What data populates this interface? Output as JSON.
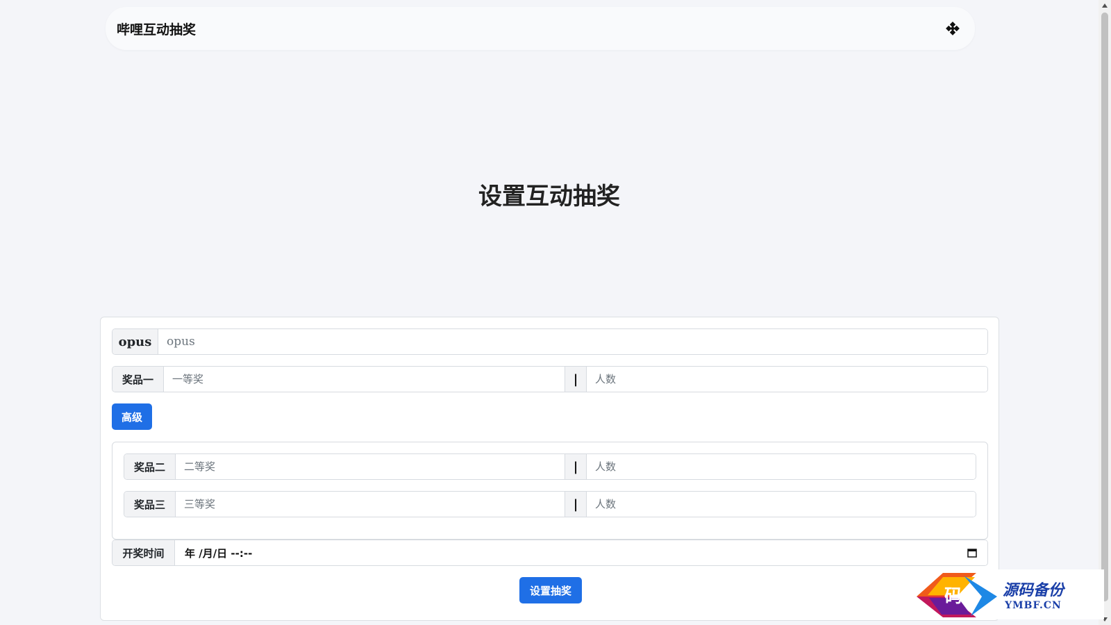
{
  "navbar": {
    "brand": "哔哩互动抽奖",
    "theme_icon": "theme-toggle-icon"
  },
  "main": {
    "title": "设置互动抽奖"
  },
  "form": {
    "opus": {
      "label": "opus",
      "placeholder": "opus",
      "value": ""
    },
    "prize1": {
      "label": "奖品一",
      "name_placeholder": "一等奖",
      "separator": "|",
      "count_placeholder": "人数"
    },
    "advanced_button": "高级",
    "prize2": {
      "label": "奖品二",
      "name_placeholder": "二等奖",
      "separator": "|",
      "count_placeholder": "人数"
    },
    "prize3": {
      "label": "奖品三",
      "name_placeholder": "三等奖",
      "separator": "|",
      "count_placeholder": "人数"
    },
    "draw_time": {
      "label": "开奖时间",
      "value": "年 /月/日 --:--"
    },
    "submit_button": "设置抽奖"
  },
  "watermark": {
    "cn": "源码备份",
    "en": "YMBF.CN",
    "logo_char": "码"
  },
  "colors": {
    "primary": "#1f6fe6",
    "background": "#f4f5f9",
    "watermark": "#1a3fa8"
  }
}
